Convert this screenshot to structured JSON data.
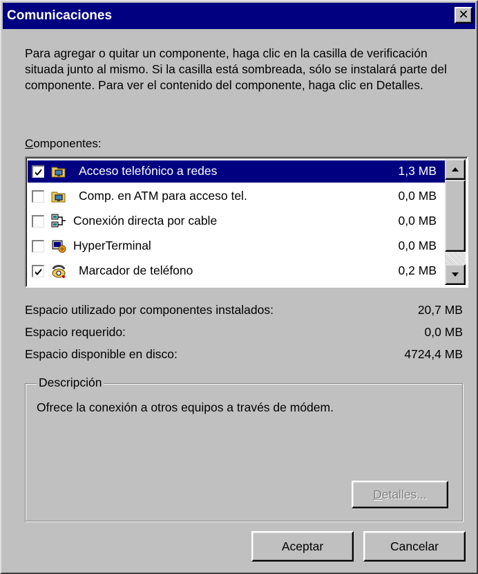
{
  "window": {
    "title": "Comunicaciones",
    "close_glyph": "✕"
  },
  "intro_text": "Para agregar o quitar un componente, haga clic en la casilla de verificación situada junto al mismo. Si la casilla está sombreada, sólo se instalará parte del componente. Para ver el contenido del componente, haga clic en Detalles.",
  "components_label": {
    "accel": "C",
    "rest": "omponentes:"
  },
  "components": [
    {
      "label": "Acceso telefónico a redes",
      "size": "1,3 MB",
      "checked": true,
      "selected": true,
      "icon": "network-folder-icon"
    },
    {
      "label": "Comp. en ATM para acceso tel.",
      "size": "0,0 MB",
      "checked": false,
      "selected": false,
      "icon": "network-folder-icon"
    },
    {
      "label": "Conexión directa por cable",
      "size": "0,0 MB",
      "checked": false,
      "selected": false,
      "icon": "computers-icon"
    },
    {
      "label": "HyperTerminal",
      "size": "0,0 MB",
      "checked": false,
      "selected": false,
      "icon": "hyperterminal-icon"
    },
    {
      "label": "Marcador de teléfono",
      "size": "0,2 MB",
      "checked": true,
      "selected": false,
      "icon": "phone-dialer-icon"
    }
  ],
  "space": [
    {
      "label": "Espacio utilizado por componentes instalados:",
      "value": "20,7 MB"
    },
    {
      "label": "Espacio requerido:",
      "value": "0,0 MB"
    },
    {
      "label": "Espacio disponible en disco:",
      "value": "4724,4 MB"
    }
  ],
  "description": {
    "legend": "Descripción",
    "text": "Ofrece la conexión a otros equipos a través de módem."
  },
  "buttons": {
    "details_accel": "D",
    "details_rest": "etalles...",
    "ok": "Aceptar",
    "cancel": "Cancelar"
  },
  "colors": {
    "face": "#c0c0c0",
    "titlebar": "#000080",
    "selection": "#000080"
  }
}
